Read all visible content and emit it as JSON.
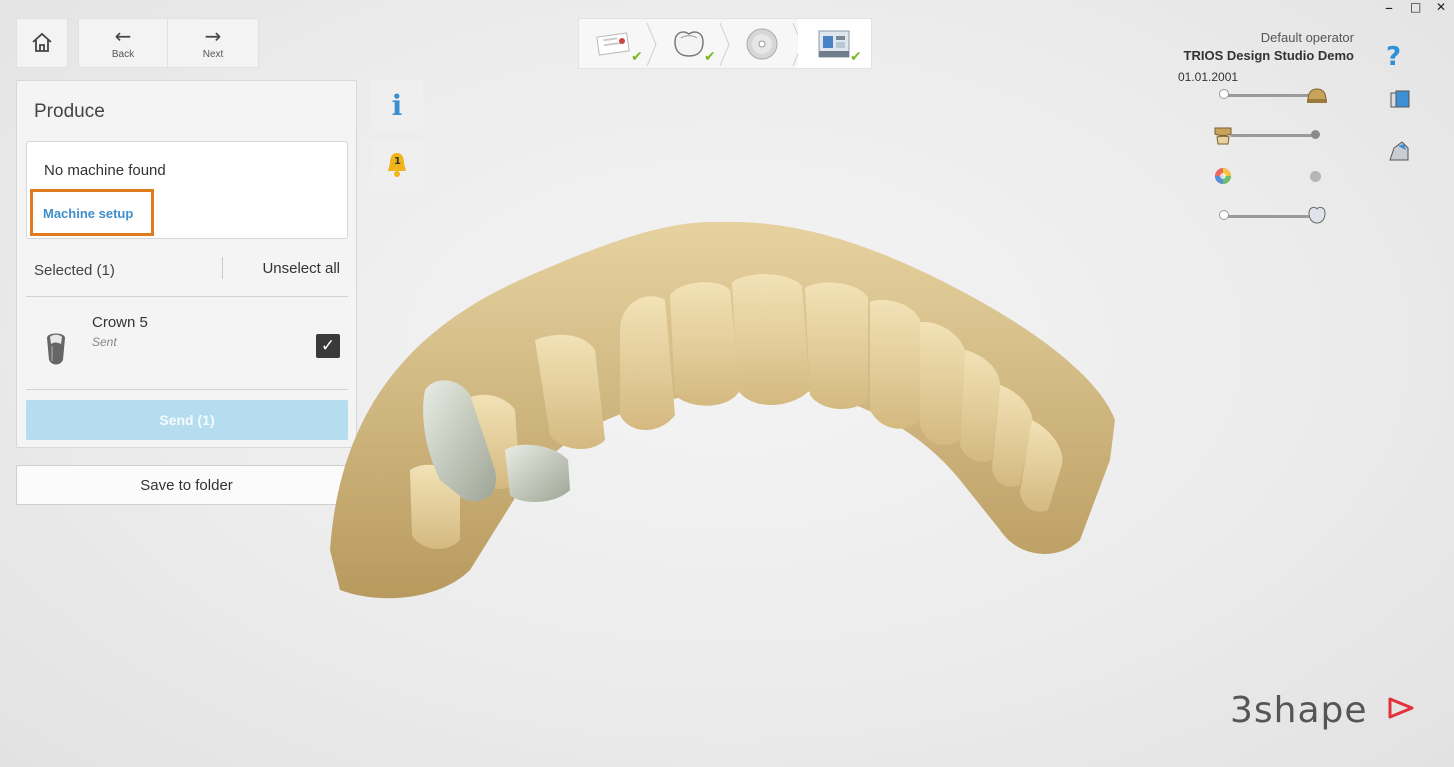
{
  "nav": {
    "back_label": "Back",
    "next_label": "Next"
  },
  "workflow_steps": [
    {
      "name": "order",
      "done": true
    },
    {
      "name": "design",
      "done": true
    },
    {
      "name": "cad",
      "done": false
    },
    {
      "name": "produce",
      "done": true,
      "active": true
    }
  ],
  "panel": {
    "title": "Produce",
    "machine_message": "No machine found",
    "machine_link": "Machine setup",
    "selected_label": "Selected (1)",
    "unselect_label": "Unselect all",
    "items": [
      {
        "name": "Crown 5",
        "status": "Sent",
        "checked": true
      }
    ],
    "send_label": "Send (1)",
    "save_label": "Save to folder"
  },
  "side_tabs": {
    "info_glyph": "i",
    "alert_count": "1"
  },
  "operator": {
    "role": "Default operator",
    "app": "TRIOS Design Studio Demo",
    "date": "01.01.2001"
  },
  "help_glyph": "?",
  "window_controls": {
    "minimize": "–",
    "maximize": "□",
    "close": "✕"
  },
  "brand": {
    "logo_text": "3shape"
  },
  "colors": {
    "accent_link": "#3f8fc9",
    "highlight_frame": "#e07b1d",
    "send_disabled": "#b6dcf0",
    "check_green": "#7ab826",
    "logo_red": "#e2313b",
    "teeth_gold": "#d9c28d"
  },
  "visibility_sliders": [
    {
      "name": "preparation-model",
      "level": 1.0
    },
    {
      "name": "antagonist",
      "level": 1.0
    },
    {
      "name": "color-texture",
      "level": 1.0
    },
    {
      "name": "restoration",
      "level": 1.0
    }
  ]
}
